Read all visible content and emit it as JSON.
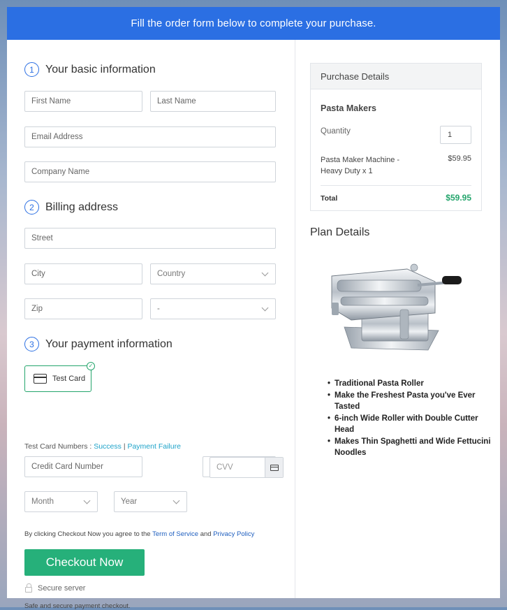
{
  "banner": {
    "text": "Fill the order form below to complete your purchase."
  },
  "basic_info": {
    "number": "1",
    "title": "Your basic information",
    "first_name_placeholder": "First Name",
    "last_name_placeholder": "Last Name",
    "email_placeholder": "Email Address",
    "company_placeholder": "Company Name"
  },
  "billing": {
    "number": "2",
    "title": "Billing address",
    "street_placeholder": "Street",
    "city_placeholder": "City",
    "country_placeholder": "Country",
    "zip_placeholder": "Zip",
    "state_placeholder": "-"
  },
  "payment": {
    "number": "3",
    "title": "Your payment information",
    "card_option_label": "Test Card",
    "test_numbers_label": "Test Card Numbers :",
    "success_link": "Success",
    "separator": "|",
    "failure_link": "Payment Failure",
    "card_number_placeholder": "Credit Card Number",
    "month_placeholder": "Month",
    "year_placeholder": "Year",
    "cvv_placeholder": "CVV"
  },
  "agreement": {
    "prefix": "By clicking Checkout Now you agree to the",
    "terms_link": "Term of Service",
    "and": "and",
    "privacy_link": "Privacy Policy"
  },
  "checkout_button": "Checkout Now",
  "secure_server": "Secure server",
  "safe_text": "Safe and secure payment checkout.",
  "purchase": {
    "heading": "Purchase Details",
    "product_title": "Pasta Makers",
    "quantity_label": "Quantity",
    "quantity_value": "1",
    "item_name": "Pasta Maker Machine - Heavy Duty x 1",
    "item_price": "$59.95",
    "total_label": "Total",
    "total_value": "$59.95"
  },
  "plan": {
    "title": "Plan Details",
    "features": [
      "Traditional Pasta Roller",
      "Make the Freshest Pasta you've Ever Tasted",
      "6-inch Wide Roller with Double Cutter Head",
      "Makes Thin Spaghetti and Wide Fettucini Noodles"
    ]
  },
  "colors": {
    "banner": "#2b6fe3",
    "checkout": "#26b07a",
    "total": "#24a56c",
    "link": "#1ea3c9"
  }
}
